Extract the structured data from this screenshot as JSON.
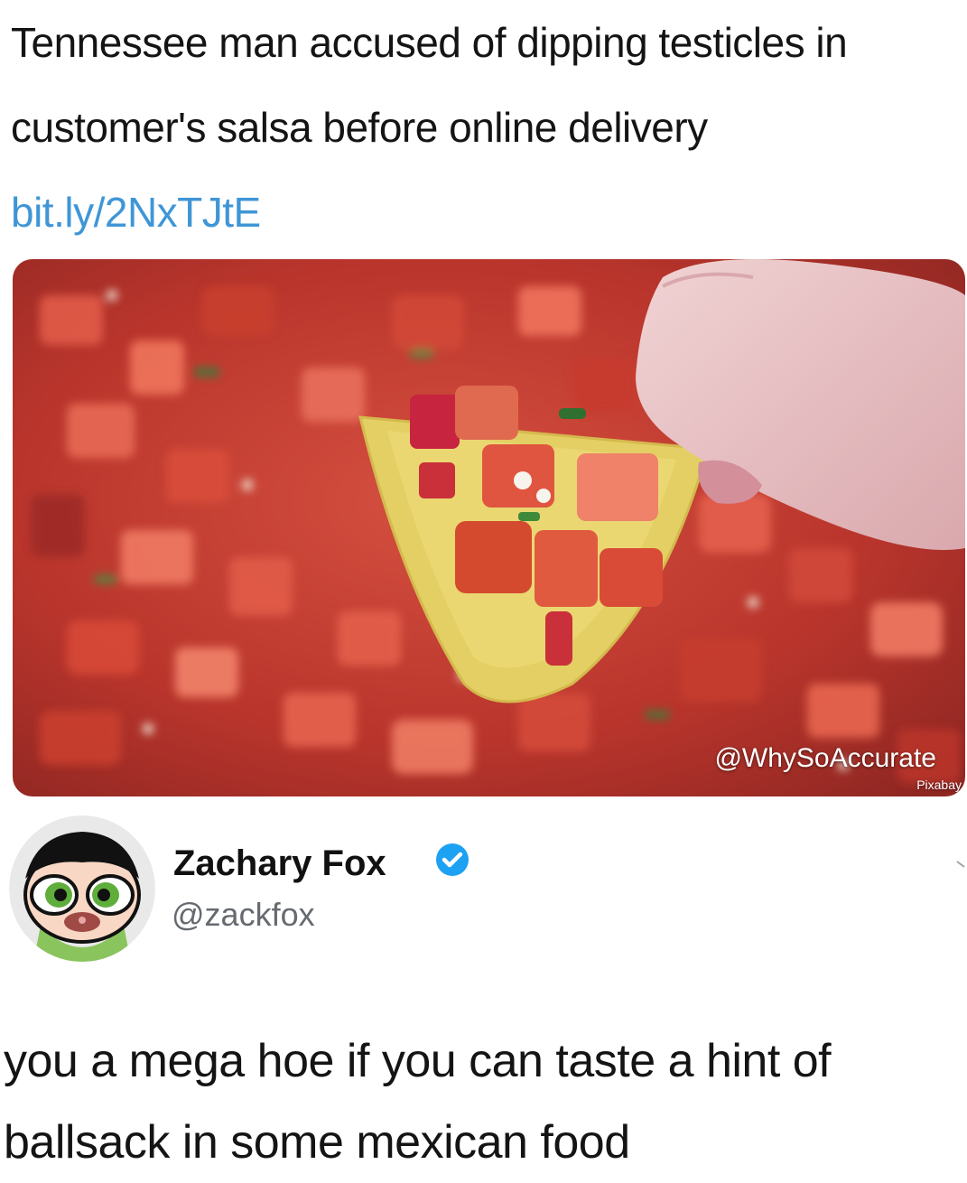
{
  "headline": {
    "text": "Tennessee man accused of dipping testicles in customer's salsa before online delivery ",
    "link": "bit.ly/2NxTJtE"
  },
  "media": {
    "watermark": "@WhySoAccurate",
    "credit": "Pixabay",
    "colors": {
      "salsa": "#c23a2c",
      "chip": "#e3cf63",
      "hand": "#e9c2c4"
    }
  },
  "reply": {
    "author_name": "Zachary Fox",
    "handle": "@zackfox",
    "verified_icon": "verified-badge-icon",
    "text": "you a mega hoe if you can taste a hint of ballsack in some mexican food"
  },
  "colors": {
    "link": "#3f96d6",
    "verified": "#1da1f2",
    "handle": "#666a70"
  }
}
